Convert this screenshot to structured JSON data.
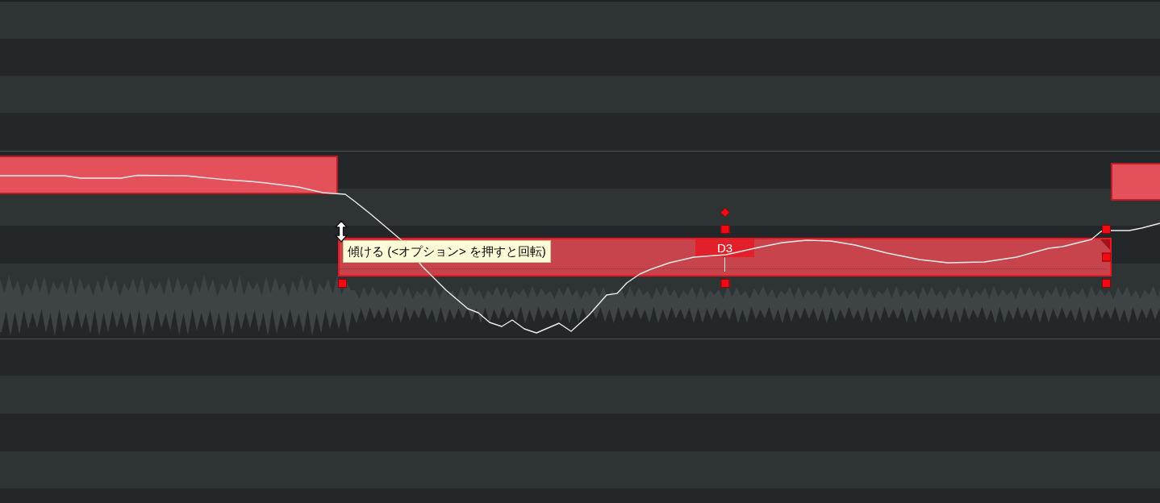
{
  "piano_roll": {
    "notes": [
      {
        "selected": false
      },
      {
        "selected": true,
        "label": "D3"
      },
      {
        "selected": false
      }
    ]
  },
  "tooltip": {
    "text": "傾ける (<オプション> を押すと回転)"
  }
}
